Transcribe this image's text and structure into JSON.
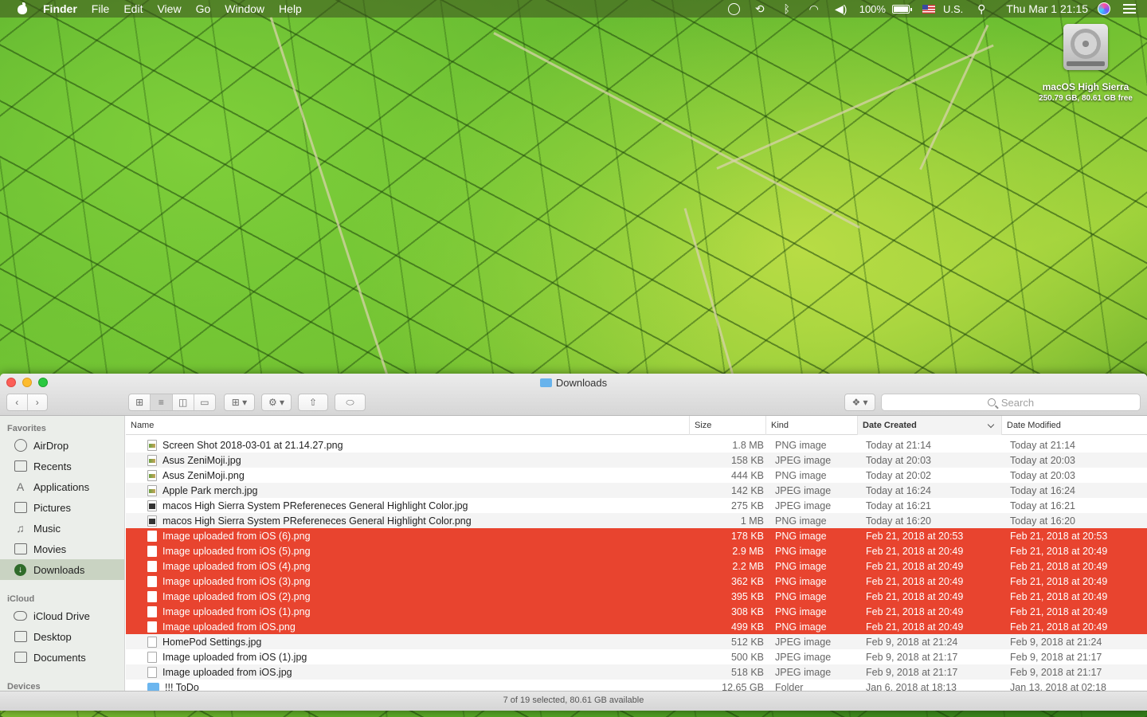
{
  "menubar": {
    "app_name": "Finder",
    "menus": [
      "File",
      "Edit",
      "View",
      "Go",
      "Window",
      "Help"
    ],
    "battery": "100%",
    "input_source": "U.S.",
    "clock": "Thu Mar 1  21:15",
    "icons": [
      "apple-icon",
      "accessibility-icon",
      "time-machine-icon",
      "bluetooth-icon",
      "wifi-icon",
      "volume-icon",
      "battery-icon",
      "flag-icon",
      "spotlight-icon",
      "siri-icon",
      "notification-center-icon"
    ]
  },
  "desktop": {
    "disk_name": "macOS High Sierra",
    "disk_info": "250.79 GB, 80.61 GB free"
  },
  "window": {
    "title": "Downloads",
    "search_placeholder": "Search",
    "status": "7 of 19 selected, 80.61 GB available"
  },
  "sidebar": {
    "favorites_header": "Favorites",
    "favorites": [
      {
        "label": "AirDrop",
        "icon": "airdrop-icon"
      },
      {
        "label": "Recents",
        "icon": "recents-icon"
      },
      {
        "label": "Applications",
        "icon": "applications-icon"
      },
      {
        "label": "Pictures",
        "icon": "pictures-icon"
      },
      {
        "label": "Music",
        "icon": "music-icon"
      },
      {
        "label": "Movies",
        "icon": "movies-icon"
      },
      {
        "label": "Downloads",
        "icon": "downloads-icon",
        "selected": true
      }
    ],
    "icloud_header": "iCloud",
    "icloud": [
      {
        "label": "iCloud Drive",
        "icon": "icloud-icon"
      },
      {
        "label": "Desktop",
        "icon": "desktop-icon"
      },
      {
        "label": "Documents",
        "icon": "documents-icon"
      }
    ],
    "devices_header": "Devices"
  },
  "columns": {
    "name": "Name",
    "size": "Size",
    "kind": "Kind",
    "created": "Date Created",
    "modified": "Date Modified"
  },
  "files": [
    {
      "name": "Screen Shot 2018-03-01 at 21.14.27.png",
      "size": "1.8 MB",
      "kind": "PNG image",
      "created": "Today at 21:14",
      "modified": "Today at 21:14",
      "selected": false,
      "icon": "img"
    },
    {
      "name": "Asus ZeniMoji.jpg",
      "size": "158 KB",
      "kind": "JPEG image",
      "created": "Today at 20:03",
      "modified": "Today at 20:03",
      "selected": false,
      "icon": "img"
    },
    {
      "name": "Asus ZeniMoji.png",
      "size": "444 KB",
      "kind": "PNG image",
      "created": "Today at 20:02",
      "modified": "Today at 20:03",
      "selected": false,
      "icon": "img"
    },
    {
      "name": "Apple Park merch.jpg",
      "size": "142 KB",
      "kind": "JPEG image",
      "created": "Today at 16:24",
      "modified": "Today at 16:24",
      "selected": false,
      "icon": "img"
    },
    {
      "name": "macos High Sierra System PRefereneces General Highlight Color.jpg",
      "size": "275 KB",
      "kind": "JPEG image",
      "created": "Today at 16:21",
      "modified": "Today at 16:21",
      "selected": false,
      "icon": "dark"
    },
    {
      "name": "macos High Sierra System PRefereneces General Highlight Color.png",
      "size": "1 MB",
      "kind": "PNG image",
      "created": "Today at 16:20",
      "modified": "Today at 16:20",
      "selected": false,
      "icon": "dark"
    },
    {
      "name": "Image uploaded from iOS (6).png",
      "size": "178 KB",
      "kind": "PNG image",
      "created": "Feb 21, 2018 at 20:53",
      "modified": "Feb 21, 2018 at 20:53",
      "selected": true,
      "icon": "doc"
    },
    {
      "name": "Image uploaded from iOS (5).png",
      "size": "2.9 MB",
      "kind": "PNG image",
      "created": "Feb 21, 2018 at 20:49",
      "modified": "Feb 21, 2018 at 20:49",
      "selected": true,
      "icon": "doc"
    },
    {
      "name": "Image uploaded from iOS (4).png",
      "size": "2.2 MB",
      "kind": "PNG image",
      "created": "Feb 21, 2018 at 20:49",
      "modified": "Feb 21, 2018 at 20:49",
      "selected": true,
      "icon": "doc"
    },
    {
      "name": "Image uploaded from iOS (3).png",
      "size": "362 KB",
      "kind": "PNG image",
      "created": "Feb 21, 2018 at 20:49",
      "modified": "Feb 21, 2018 at 20:49",
      "selected": true,
      "icon": "doc"
    },
    {
      "name": "Image uploaded from iOS (2).png",
      "size": "395 KB",
      "kind": "PNG image",
      "created": "Feb 21, 2018 at 20:49",
      "modified": "Feb 21, 2018 at 20:49",
      "selected": true,
      "icon": "doc"
    },
    {
      "name": "Image uploaded from iOS (1).png",
      "size": "308 KB",
      "kind": "PNG image",
      "created": "Feb 21, 2018 at 20:49",
      "modified": "Feb 21, 2018 at 20:49",
      "selected": true,
      "icon": "doc"
    },
    {
      "name": "Image uploaded from iOS.png",
      "size": "499 KB",
      "kind": "PNG image",
      "created": "Feb 21, 2018 at 20:49",
      "modified": "Feb 21, 2018 at 20:49",
      "selected": true,
      "icon": "doc"
    },
    {
      "name": "HomePod Settings.jpg",
      "size": "512 KB",
      "kind": "JPEG image",
      "created": "Feb 9, 2018 at 21:24",
      "modified": "Feb 9, 2018 at 21:24",
      "selected": false,
      "icon": "doc"
    },
    {
      "name": "Image uploaded from iOS (1).jpg",
      "size": "500 KB",
      "kind": "JPEG image",
      "created": "Feb 9, 2018 at 21:17",
      "modified": "Feb 9, 2018 at 21:17",
      "selected": false,
      "icon": "doc"
    },
    {
      "name": "Image uploaded from iOS.jpg",
      "size": "518 KB",
      "kind": "JPEG image",
      "created": "Feb 9, 2018 at 21:17",
      "modified": "Feb 9, 2018 at 21:17",
      "selected": false,
      "icon": "doc"
    },
    {
      "name": "!!! ToDo",
      "size": "12.65 GB",
      "kind": "Folder",
      "created": "Jan 6, 2018 at 18:13",
      "modified": "Jan 13, 2018 at 02:18",
      "selected": false,
      "icon": "folder"
    }
  ],
  "colors": {
    "selection": "#e8442f",
    "sidebar_bg": "#ebeeea"
  }
}
